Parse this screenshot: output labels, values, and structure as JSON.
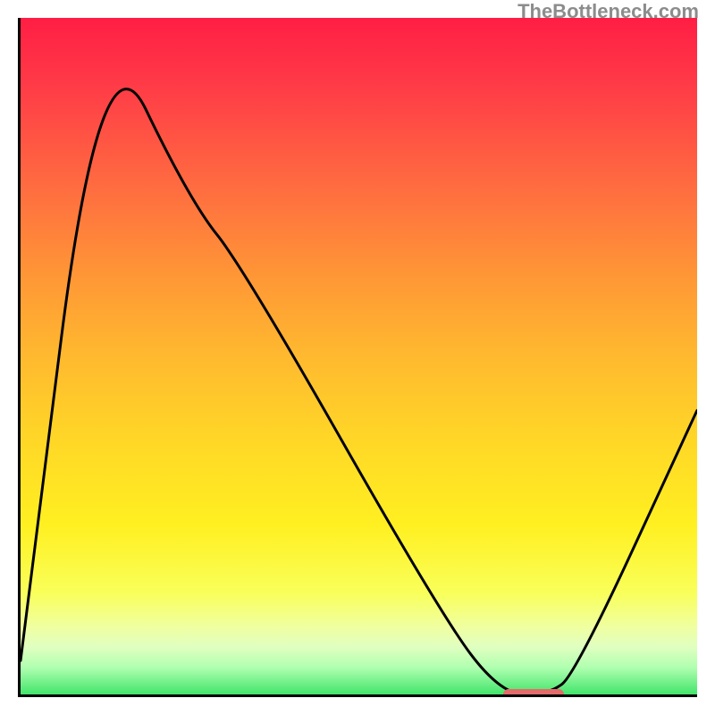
{
  "watermark": "TheBottleneck.com",
  "chart_data": {
    "type": "line",
    "title": "",
    "xlabel": "",
    "ylabel": "",
    "xlim": [
      0,
      100
    ],
    "ylim": [
      0,
      100
    ],
    "x": [
      0,
      12,
      25,
      33,
      62,
      71,
      78,
      82,
      100
    ],
    "y": [
      5,
      100,
      73,
      63,
      12,
      0,
      0,
      3,
      42
    ],
    "marker": {
      "x_start": 71,
      "x_end": 80,
      "y": 0
    },
    "gradient_note": "vertical gradient from red (top, high bottleneck) through orange/yellow to green (bottom, optimal)"
  }
}
